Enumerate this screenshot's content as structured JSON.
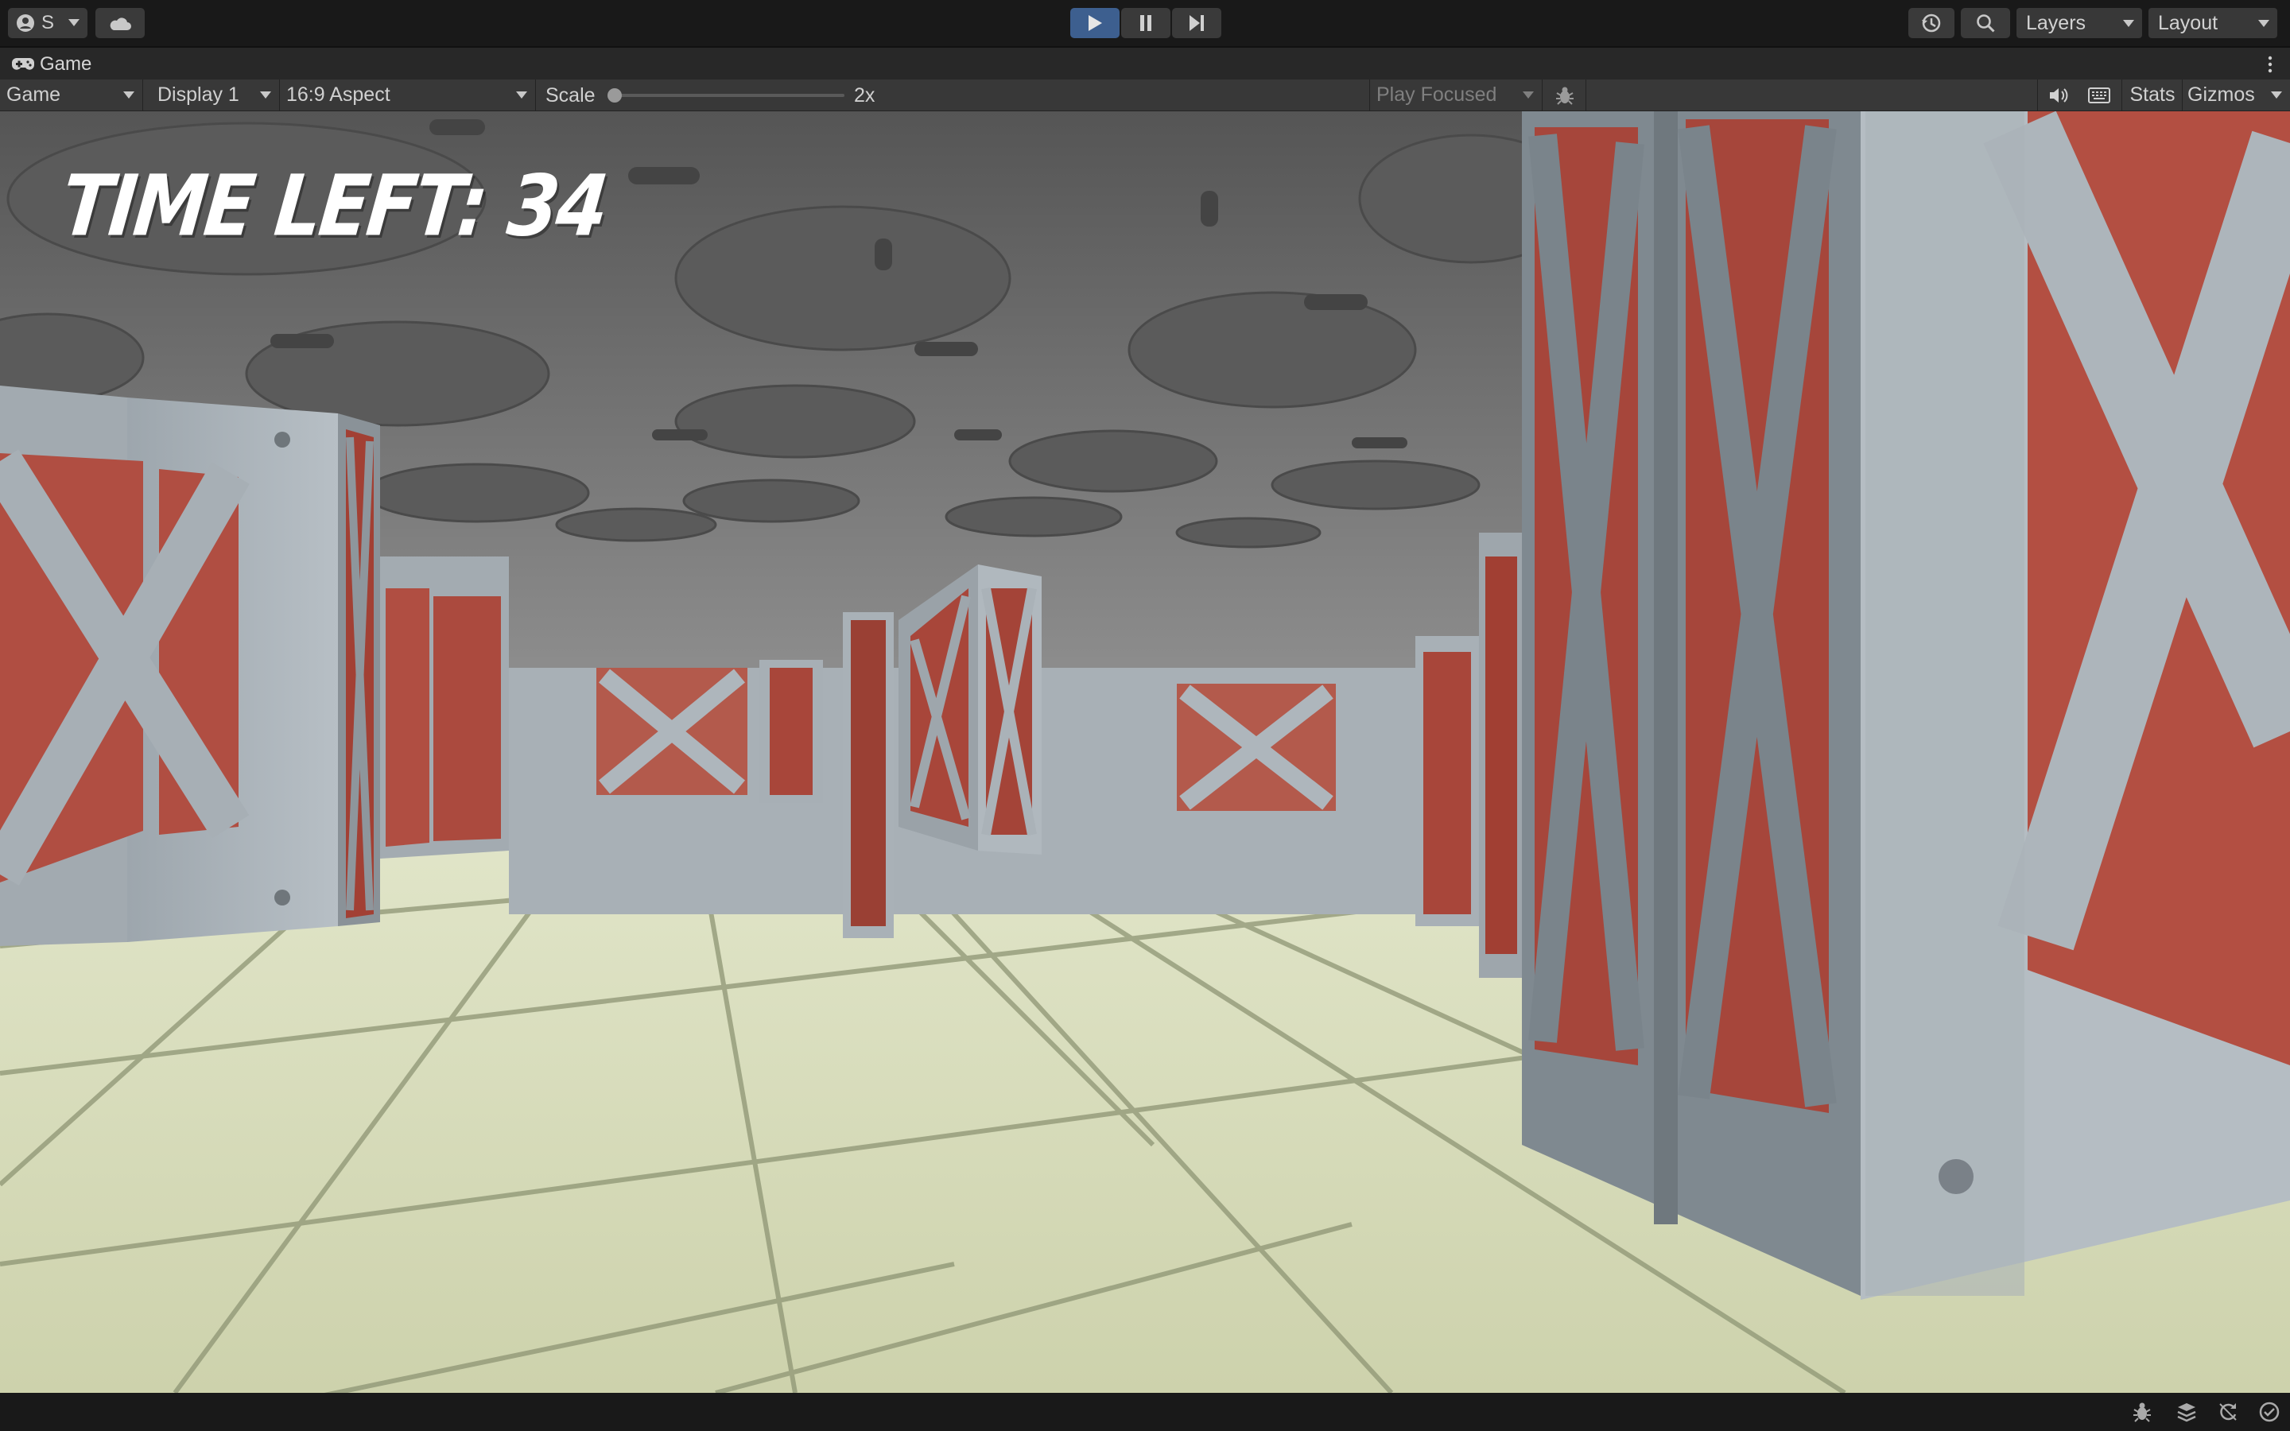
{
  "toolbar": {
    "account_label": "S",
    "icons": [
      "account-icon",
      "cloud-icon",
      "play-icon",
      "pause-icon",
      "step-icon",
      "history-icon",
      "search-icon"
    ],
    "layers_label": "Layers",
    "layout_label": "Layout",
    "play_accent": "#3d5f8f"
  },
  "game_tab": {
    "title": "Game",
    "icon": "gamepad-icon"
  },
  "game_controls": {
    "view_mode": "Game",
    "display": "Display 1",
    "aspect": "16:9 Aspect",
    "scale_label": "Scale",
    "scale_value": "2x",
    "play_mode": "Play Focused",
    "stats_label": "Stats",
    "gizmos_label": "Gizmos",
    "icons": [
      "bug-icon",
      "speaker-icon",
      "keyboard-icon"
    ]
  },
  "hud": {
    "time_left": "TIME LEFT: 34"
  },
  "statusbar": {
    "icons": [
      "debug-icon",
      "stack-icon",
      "refresh-icon",
      "check-icon"
    ]
  }
}
